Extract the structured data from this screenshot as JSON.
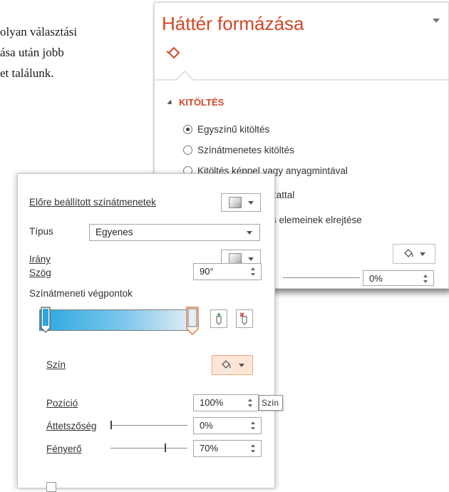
{
  "document": {
    "lines": [
      "olyan választási",
      "ása  után  jobb",
      "et találunk."
    ]
  },
  "back_panel": {
    "title": "Háttér formázása",
    "fill_icon": "paint-bucket-icon",
    "section_title": "KITÖLTÉS",
    "options": [
      {
        "label": "Egyszínű kitöltés",
        "selected": true
      },
      {
        "label": "Színátmenetes kitöltés",
        "selected": false
      },
      {
        "label": "Kitöltés képpel vagy anyagmintával",
        "selected": false
      },
      {
        "label": "zattal",
        "selected": false
      },
      {
        "label": "s elemeinek elrejtése",
        "selected": null
      }
    ],
    "transparency_value": "0%",
    "colors": {
      "accent": "#d24726"
    }
  },
  "front_panel": {
    "preset_label": "Előre beállított színátmenetek",
    "type_label": "Típus",
    "type_value": "Egyenes",
    "direction_label": "Irány",
    "angle_label": "Szög",
    "angle_value": "90°",
    "stops_label": "Színátmeneti végpontok",
    "color_label": "Szín",
    "position_label": "Pozíció",
    "position_value": "100%",
    "transparency_label": "Áttetszőség",
    "transparency_value": "0%",
    "transparency_level": 0,
    "brightness_label": "Fényerő",
    "brightness_value": "70%",
    "brightness_level": 0.7,
    "tooltip": "Szín",
    "gradient_colors": [
      "#2aa8e0",
      "#e6eef5"
    ]
  }
}
